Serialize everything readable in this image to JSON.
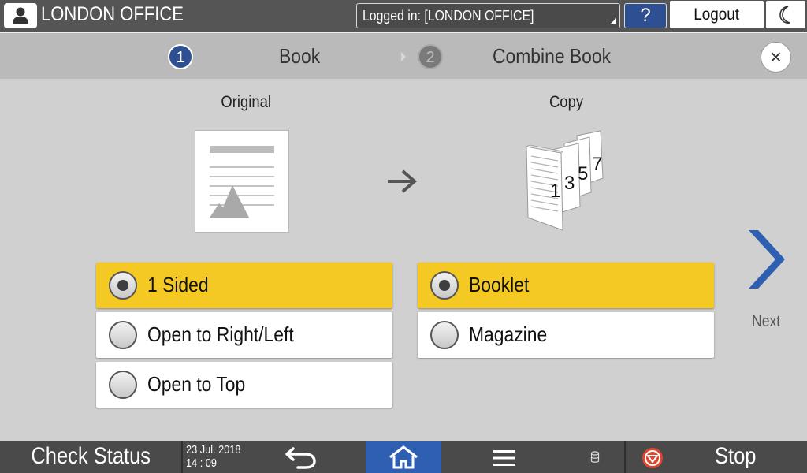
{
  "header": {
    "office_name": "LONDON OFFICE",
    "login_status": "Logged in: [LONDON OFFICE]",
    "help_label": "?",
    "logout_label": "Logout"
  },
  "steps": [
    {
      "number": "1",
      "label": "Book",
      "active": true
    },
    {
      "number": "2",
      "label": "Combine Book",
      "active": false
    }
  ],
  "close_label": "×",
  "original": {
    "heading": "Original",
    "options": [
      {
        "label": "1 Sided",
        "selected": true
      },
      {
        "label": "Open to Right/Left",
        "selected": false
      },
      {
        "label": "Open to Top",
        "selected": false
      }
    ]
  },
  "copy": {
    "heading": "Copy",
    "page_numbers": [
      "1",
      "3",
      "5",
      "7"
    ],
    "options": [
      {
        "label": "Booklet",
        "selected": true
      },
      {
        "label": "Magazine",
        "selected": false
      }
    ]
  },
  "next_label": "Next",
  "footer": {
    "check_status": "Check Status",
    "date": "23 Jul. 2018",
    "time": "14 : 09",
    "stop_label": "Stop"
  },
  "colors": {
    "selected_option": "#f4c924",
    "accent_blue": "#2f4f93",
    "home_blue": "#2f5fb0",
    "stop_red": "#e0452d"
  },
  "icons": {
    "user": "user-icon",
    "moon": "moon-icon",
    "close": "close-icon",
    "next": "chevron-right-icon",
    "back": "back-arrow-icon",
    "home": "home-icon",
    "menu": "menu-icon",
    "data": "data-icon",
    "stop": "stop-icon"
  }
}
